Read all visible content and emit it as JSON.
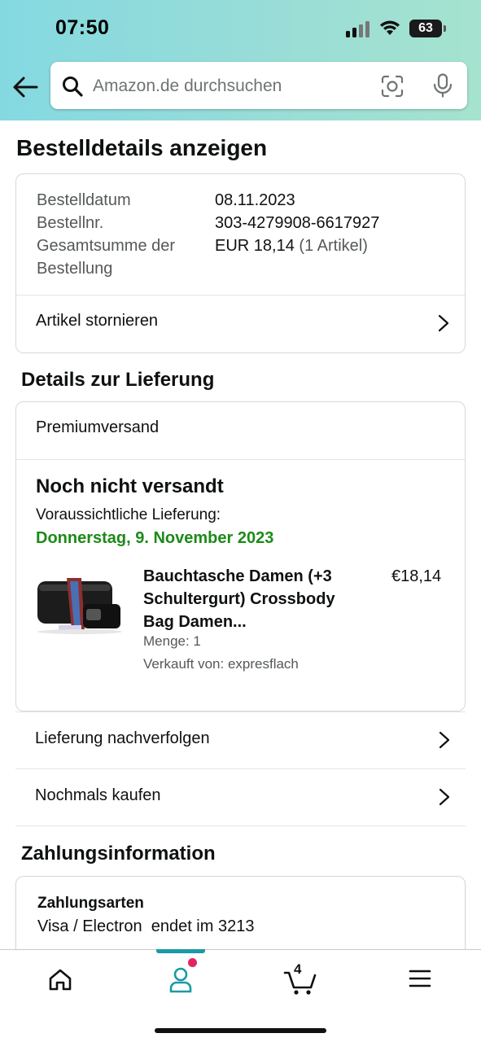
{
  "status_bar": {
    "time": "07:50",
    "battery": "63"
  },
  "search": {
    "placeholder": "Amazon.de durchsuchen"
  },
  "page_title": "Bestelldetails anzeigen",
  "order": {
    "date_label": "Bestelldatum",
    "date_value": "08.11.2023",
    "number_label": "Bestellnr.",
    "number_value": "303-4279908-6617927",
    "total_label_line1": "Gesamtsumme der",
    "total_label_line2": "Bestellung",
    "total_value": "EUR 18,14",
    "total_items": "(1 Artikel)",
    "cancel_label": "Artikel stornieren"
  },
  "delivery": {
    "section_title": "Details zur Lieferung",
    "shipping_method": "Premiumversand",
    "status": "Noch nicht versandt",
    "expected_label": "Voraussichtliche Lieferung:",
    "expected_date": "Donnerstag, 9. November 2023",
    "product": {
      "title": "Bauchtasche Damen (+3 Schultergurt) Crossbody Bag Damen...",
      "price": "€18,14",
      "quantity": "Menge: 1",
      "seller": "Verkauft von: expresflach"
    },
    "track_label": "Lieferung nachverfolgen",
    "buy_again_label": "Nochmals kaufen"
  },
  "payment": {
    "section_title": "Zahlungsinformation",
    "methods_title": "Zahlungsarten",
    "method_value": "Visa / Electron  endet im 3213"
  },
  "bottom_nav": {
    "items": [
      "home-icon",
      "account-icon",
      "cart-icon",
      "menu-icon"
    ],
    "cart_count": "4",
    "active": "account-icon"
  },
  "colors": {
    "header_gradient_start": "#84d9e1",
    "header_gradient_end": "#a6e3cf",
    "delivery_date": "#1d8a18",
    "active_nav": "#1a9aa3",
    "notification_dot": "#e3245f"
  }
}
